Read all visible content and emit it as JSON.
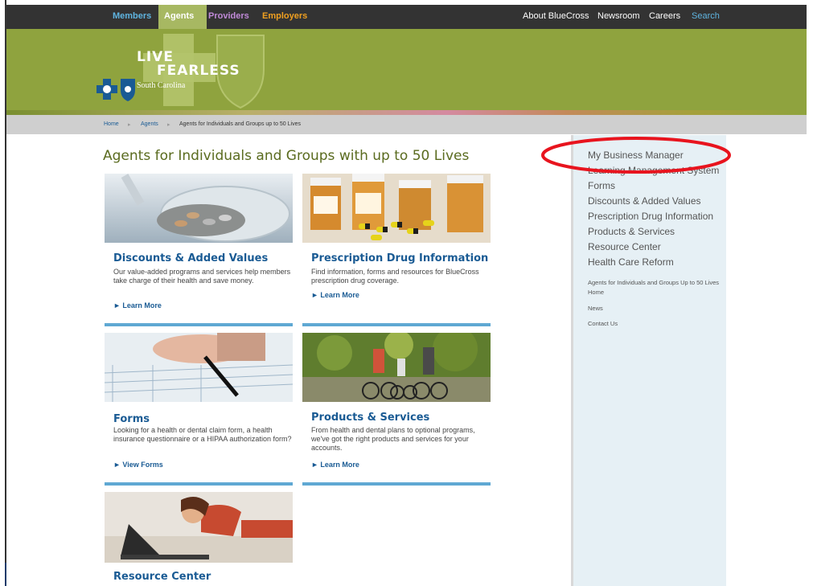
{
  "topnav": {
    "members": "Members",
    "agents": "Agents",
    "providers": "Providers",
    "employers": "Employers",
    "about": "About BlueCross",
    "newsroom": "Newsroom",
    "careers": "Careers",
    "search": "Search"
  },
  "logo": {
    "line1": "LIVE",
    "line2": "FEARLESS",
    "line3": "South Carolina"
  },
  "breadcrumb": {
    "home": "Home",
    "agents": "Agents",
    "current": "Agents for Individuals and Groups up to 50 Lives",
    "separator": "▸"
  },
  "main": {
    "title": "Agents for Individuals and Groups with up to 50 Lives",
    "cards": [
      {
        "title": "Discounts & Added Values",
        "desc": "Our value-added programs and services help members take charge of their health and save money.",
        "link": "Learn More"
      },
      {
        "title": "Prescription Drug Information",
        "desc": "Find information, forms and resources for BlueCross prescription drug coverage.",
        "link": "Learn More"
      },
      {
        "title": "Forms",
        "desc": "Looking for a health or dental claim form, a health insurance questionnaire or a HIPAA authorization form?",
        "link": "View Forms"
      },
      {
        "title": "Products & Services",
        "desc": "From health and dental plans to optional programs, we've got the right products and services for your accounts.",
        "link": "Learn More"
      },
      {
        "title": "Resource Center",
        "desc": "",
        "link": ""
      }
    ]
  },
  "sidebar": {
    "items": [
      "My Business Manager",
      "Learning Management System",
      "Forms",
      "Discounts & Added Values",
      "Prescription Drug Information",
      "Products & Services",
      "Resource Center",
      "Health Care Reform"
    ],
    "small_items": [
      "Agents for Individuals and Groups Up to 50 Lives Home",
      "News",
      "Contact Us"
    ]
  },
  "colors": {
    "topbar": "#333333",
    "banner": "#8fa33e",
    "link_blue": "#1a5b94",
    "highlight_circle": "#e8141e"
  }
}
